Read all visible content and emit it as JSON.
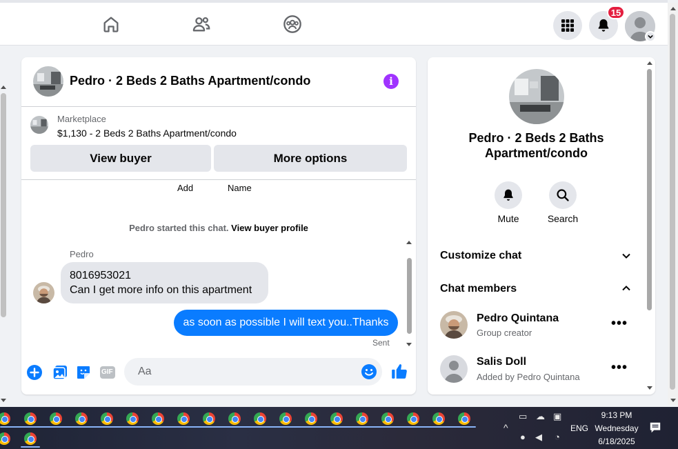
{
  "nav": {
    "icons": [
      "home-icon",
      "people-icon",
      "groups-icon"
    ],
    "notifications_badge": "15"
  },
  "chat": {
    "title": "Pedro · 2 Beds 2 Baths Apartment/condo",
    "marketplace": {
      "label": "Marketplace",
      "listing": "$1,130 - 2 Beds 2 Baths Apartment/condo",
      "view_buyer": "View buyer",
      "more_options": "More options"
    },
    "hints": [
      "Add",
      "Name"
    ],
    "started_text": "Pedro started this chat.",
    "view_buyer_profile": "View buyer profile",
    "sender": "Pedro",
    "incoming_lines": [
      "8016953021",
      "Can I get more info on this apartment"
    ],
    "outgoing": "as soon as possible I will text you..Thanks",
    "sent_status": "Sent",
    "composer_placeholder": "Aa",
    "composer_icons": [
      "plus-icon",
      "photo-icon",
      "sticker-icon",
      "gif-icon",
      "emoji-icon",
      "like-icon"
    ],
    "gif_label": "GIF"
  },
  "info": {
    "title": "Pedro · 2 Beds 2 Baths Apartment/condo",
    "actions": [
      {
        "label": "Mute",
        "icon": "bell-icon"
      },
      {
        "label": "Search",
        "icon": "search-icon"
      }
    ],
    "customize_chat": "Customize chat",
    "chat_members": "Chat members",
    "members": [
      {
        "name": "Pedro Quintana",
        "role": "Group creator"
      },
      {
        "name": "Salis Doll",
        "role": "Added by Pedro Quintana"
      }
    ]
  },
  "taskbar": {
    "time": "9:13 PM",
    "day": "Wednesday",
    "date": "6/18/2025",
    "lang": "ENG"
  },
  "colors": {
    "messenger_blue": "#0a7cff",
    "info_purple": "#a033ff",
    "badge_red": "#e41e3f"
  }
}
